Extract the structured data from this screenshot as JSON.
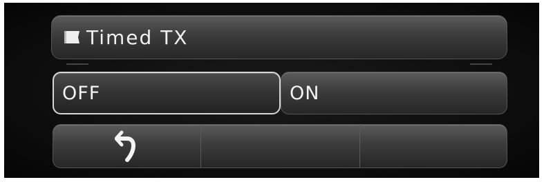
{
  "screen": {
    "title": "Timed TX",
    "title_icon": "flag-icon"
  },
  "options": {
    "off_label": "OFF",
    "on_label": "ON",
    "selected": "OFF"
  },
  "bottom_bar": {
    "back_icon": "return-arrow-icon"
  },
  "colors": {
    "background": "#0c0c0c",
    "button_top": "#5b5b5b",
    "button_bottom": "#262626",
    "selected_border": "#d8d8d8",
    "text": "#f2f2f2"
  }
}
